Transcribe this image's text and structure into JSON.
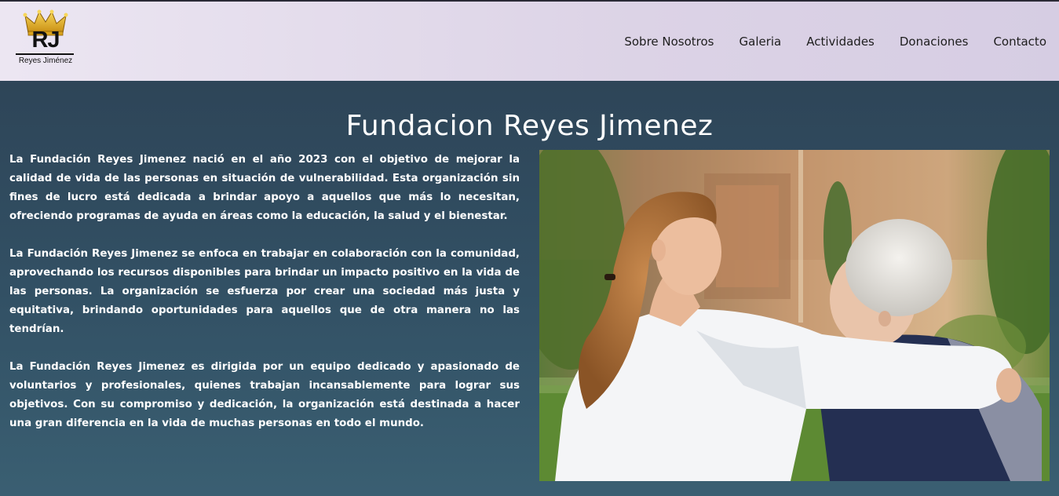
{
  "header": {
    "logo": {
      "monogram": "RJ",
      "name": "Reyes Jiménez",
      "icon": "crown-icon"
    },
    "nav": [
      {
        "label": "Sobre Nosotros"
      },
      {
        "label": "Galeria"
      },
      {
        "label": "Actividades"
      },
      {
        "label": "Donaciones"
      },
      {
        "label": "Contacto"
      }
    ]
  },
  "main": {
    "title": "Fundacion Reyes Jimenez",
    "paragraphs": [
      "La Fundación Reyes Jimenez nació en el año 2023 con el objetivo de mejorar la calidad de vida de las personas en situación de vulnerabilidad. Esta organización sin fines de lucro está dedicada a brindar apoyo a aquellos que más lo necesitan, ofreciendo programas de ayuda en áreas como la educación, la salud y el bienestar.",
      "La Fundación Reyes Jimenez se enfoca en trabajar en colaboración con la comunidad, aprovechando los recursos disponibles para brindar un impacto positivo en la vida de las personas. La organización se esfuerza por crear una sociedad más justa y equitativa, brindando oportunidades para aquellos que de otra manera no las tendrían.",
      "La Fundación Reyes Jimenez es dirigida por un equipo dedicado y apasionado de voluntarios y profesionales, quienes trabajan incansablemente para lograr sus objetivos. Con su compromiso y dedicación, la organización está destinada a hacer una gran diferencia en la vida de muchas personas en todo el mundo."
    ],
    "image": "caregiver-with-elderly-woman-photo"
  },
  "colors": {
    "header_bg": "#e2dbeb",
    "main_bg": "#2f4a5c",
    "crown": "#e6b422"
  }
}
